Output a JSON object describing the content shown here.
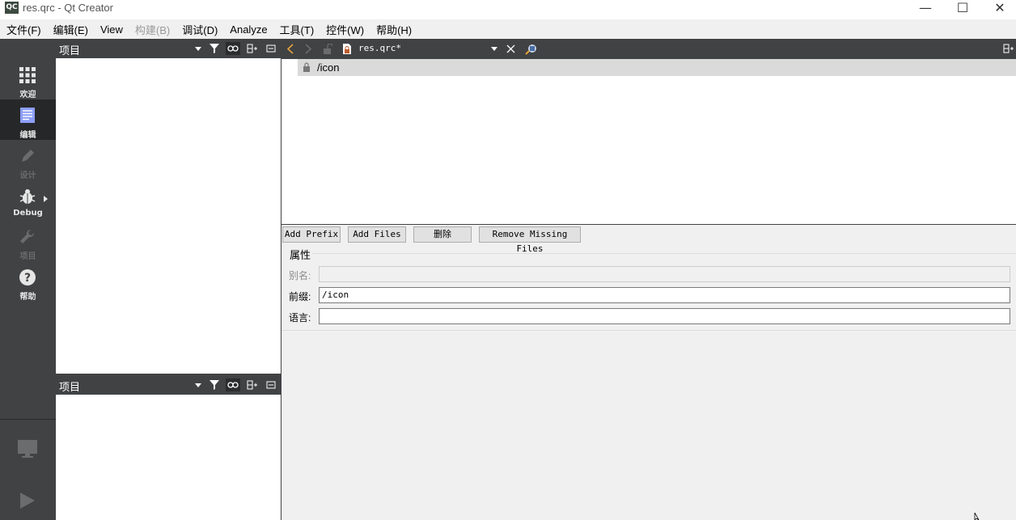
{
  "window": {
    "icon_text": "QC",
    "title": "res.qrc - Qt Creator",
    "minimize": "—",
    "maximize": "☐",
    "close": "✕"
  },
  "menu": [
    {
      "label": "文件(F)",
      "enabled": true
    },
    {
      "label": "编辑(E)",
      "enabled": true
    },
    {
      "label": "View",
      "enabled": true
    },
    {
      "label": "构建(B)",
      "enabled": false
    },
    {
      "label": "调试(D)",
      "enabled": true
    },
    {
      "label": "Analyze",
      "enabled": true
    },
    {
      "label": "工具(T)",
      "enabled": true
    },
    {
      "label": "控件(W)",
      "enabled": true
    },
    {
      "label": "帮助(H)",
      "enabled": true
    }
  ],
  "modes": {
    "welcome": "欢迎",
    "edit": "编辑",
    "design": "设计",
    "debug": "Debug",
    "projects": "项目",
    "help": "帮助"
  },
  "panes": {
    "top_title": "项目",
    "bottom_title": "项目"
  },
  "editor": {
    "document": "res.qrc*"
  },
  "tree": {
    "prefix_item": "/icon"
  },
  "buttons": {
    "add_prefix": "Add Prefix",
    "add_files": "Add Files",
    "delete": "删除",
    "remove_missing": "Remove Missing Files"
  },
  "properties": {
    "title": "属性",
    "alias_label": "别名:",
    "alias_value": "",
    "prefix_label": "前缀:",
    "prefix_value": "/icon",
    "language_label": "语言:",
    "language_value": ""
  }
}
